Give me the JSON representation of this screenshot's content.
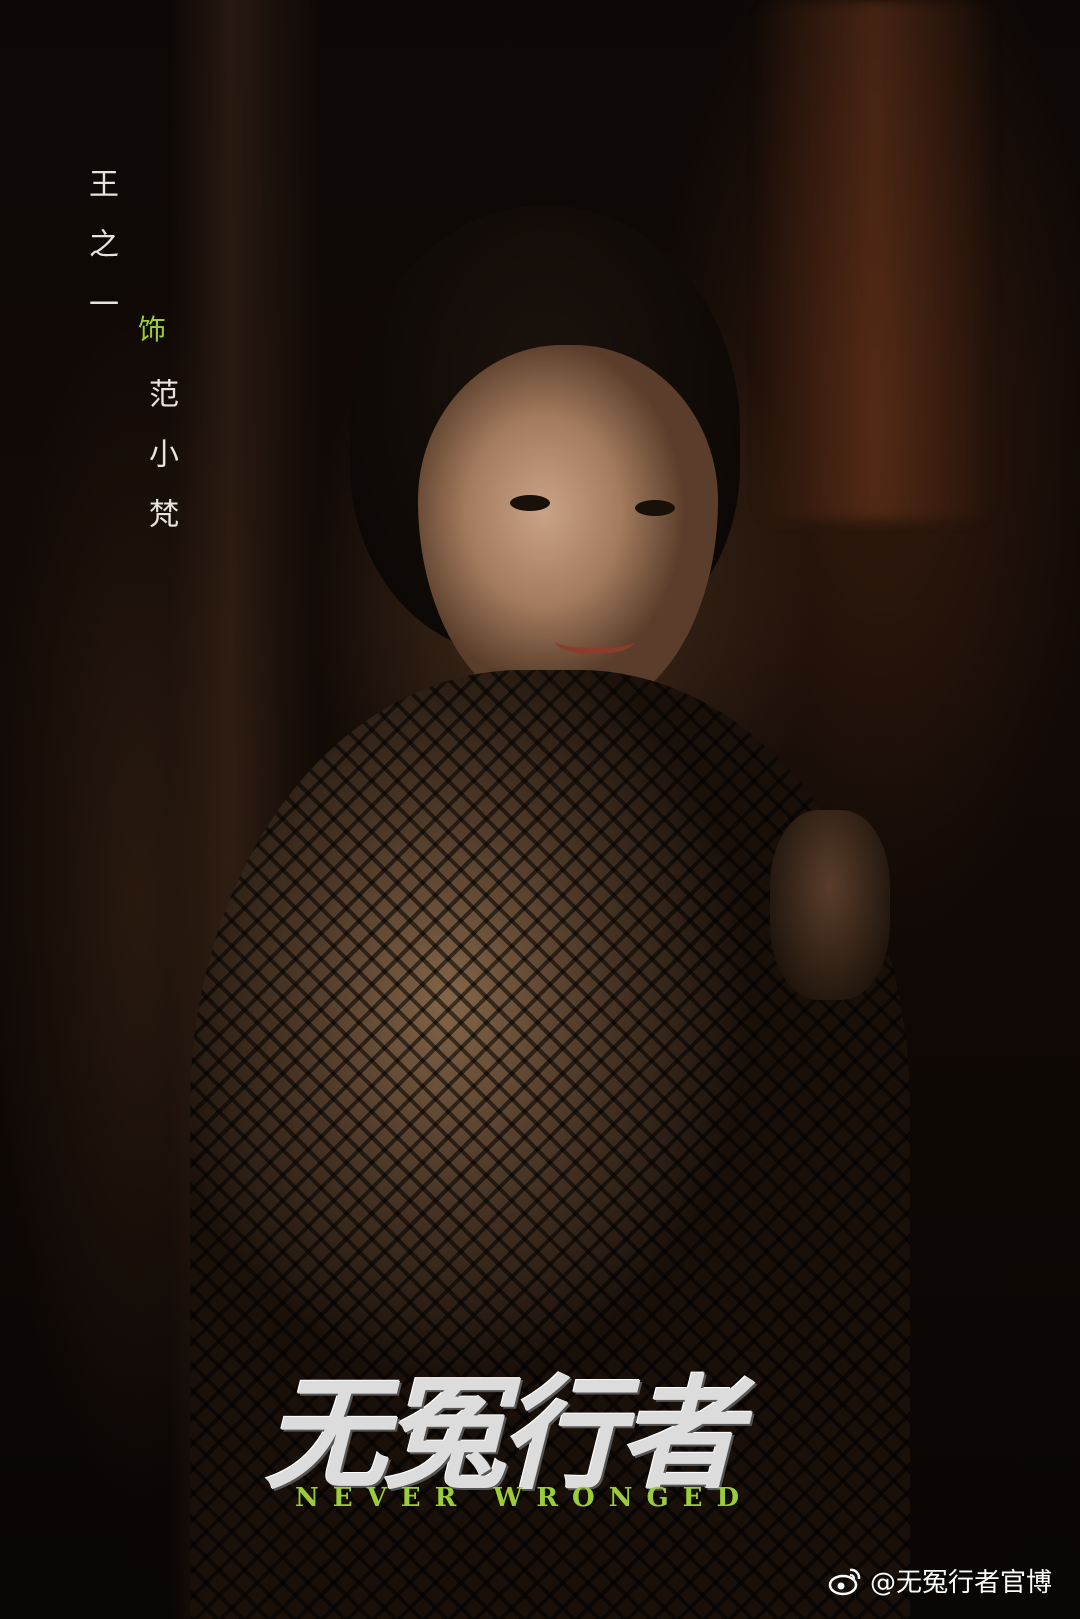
{
  "poster": {
    "actor_name": "王之一",
    "role_mark": "饰",
    "character_name": "范小梵",
    "title_cn": "无冤行者",
    "title_en": "NEVER WRONGED"
  },
  "watermark": {
    "icon": "weibo-icon",
    "handle": "@无冤行者官博"
  },
  "colors": {
    "accent": "#9ccc3a",
    "text": "#e8e3dc",
    "background": "#0b0705"
  }
}
